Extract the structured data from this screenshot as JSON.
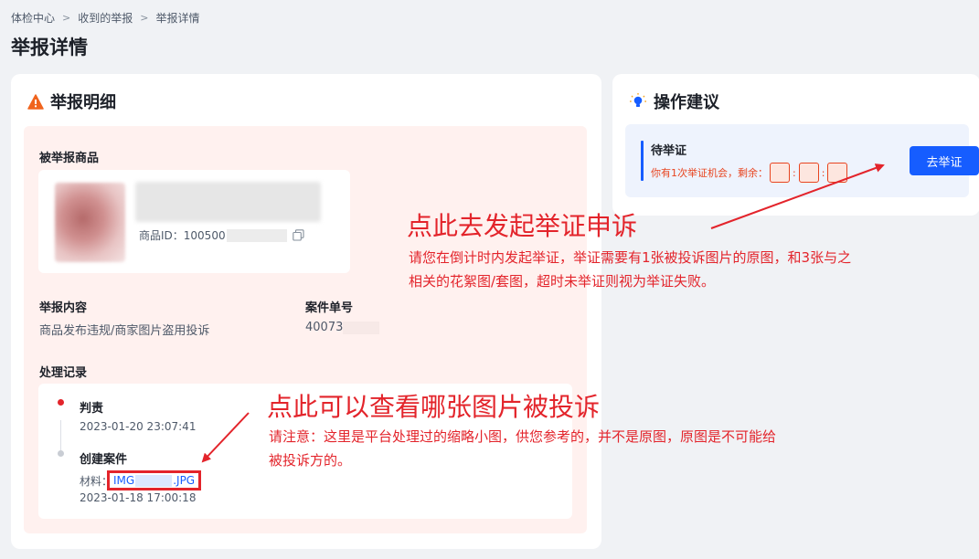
{
  "breadcrumb": {
    "item1": "体检中心",
    "item2": "收到的举报",
    "item3": "举报详情",
    "separator": ">"
  },
  "page_title": "举报详情",
  "left_card": {
    "title": "举报明细",
    "reported_product_label": "被举报商品",
    "product_id_prefix": "商品ID：100500",
    "report_content_label": "举报内容",
    "report_content_value": "商品发布违规/商家图片盗用投诉",
    "case_no_label": "案件单号",
    "case_no_value": "40073",
    "records_label": "处理记录",
    "records": [
      {
        "title": "判责",
        "time": "2023-01-20 23:07:41",
        "dot_color": "#e3242b"
      },
      {
        "title": "创建案件",
        "material_label": "材料：",
        "file_prefix": "IMG",
        "file_suffix": ".JPG",
        "time": "2023-01-18 17:00:18",
        "dot_color": "#c9cdd4"
      }
    ]
  },
  "right_card": {
    "title": "操作建议",
    "pending_title": "待举证",
    "chance_text": "你有1次举证机会，剩余：",
    "colon": ":",
    "button_label": "去举证"
  },
  "annotations": {
    "a1_title": "点此去发起举证申诉",
    "a1_line1": "请您在倒计时内发起举证，举证需要有1张被投诉图片的原图，和3张与之",
    "a1_line2": "相关的花絮图/套图，超时未举证则视为举证失败。",
    "a2_title": "点此可以查看哪张图片被投诉",
    "a2_line1": "请注意：这里是平台处理过的缩略小图，供您参考的，并不是原图，原图是不可能给",
    "a2_line2": "被投诉方的。"
  },
  "colors": {
    "accent": "#165dff",
    "annotation": "#e3242b",
    "countdown": "#e8441f"
  },
  "icons": {
    "warning": "warning-icon",
    "bulb": "lightbulb-icon",
    "copy": "copy-icon"
  }
}
